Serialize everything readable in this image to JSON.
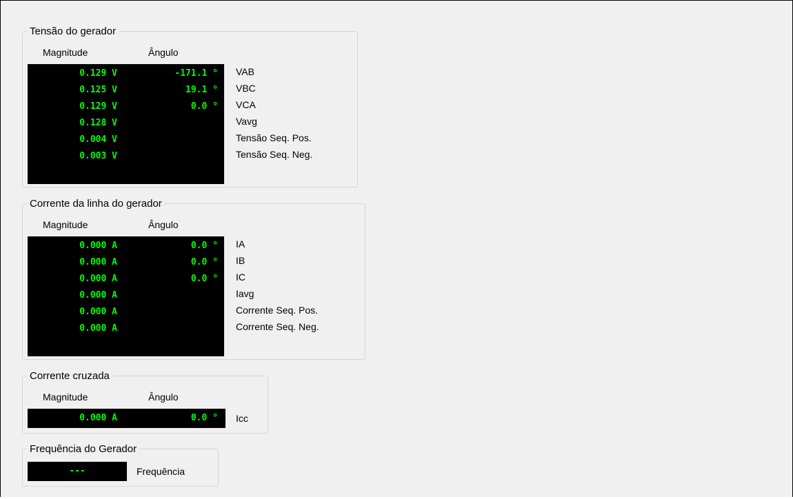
{
  "voltage": {
    "title": "Tensão do gerador",
    "magnitude_header": "Magnitude",
    "angle_header": "Ângulo",
    "rows": [
      {
        "magnitude": "0.129 V",
        "angle": "-171.1 °",
        "label": "VAB"
      },
      {
        "magnitude": "0.125 V",
        "angle": "19.1 °",
        "label": "VBC"
      },
      {
        "magnitude": "0.129 V",
        "angle": "0.0 °",
        "label": "VCA"
      },
      {
        "magnitude": "0.128 V",
        "angle": "",
        "label": "Vavg"
      },
      {
        "magnitude": "0.004 V",
        "angle": "",
        "label": "Tensão Seq. Pos."
      },
      {
        "magnitude": "0.003 V",
        "angle": "",
        "label": "Tensão Seq. Neg."
      }
    ]
  },
  "current": {
    "title": "Corrente da linha do gerador",
    "magnitude_header": "Magnitude",
    "angle_header": "Ângulo",
    "rows": [
      {
        "magnitude": "0.000 A",
        "angle": "0.0 °",
        "label": "IA"
      },
      {
        "magnitude": "0.000 A",
        "angle": "0.0 °",
        "label": "IB"
      },
      {
        "magnitude": "0.000 A",
        "angle": "0.0 °",
        "label": "IC"
      },
      {
        "magnitude": "0.000 A",
        "angle": "",
        "label": "Iavg"
      },
      {
        "magnitude": "0.000 A",
        "angle": "",
        "label": "Corrente Seq. Pos."
      },
      {
        "magnitude": "0.000 A",
        "angle": "",
        "label": "Corrente Seq. Neg."
      }
    ]
  },
  "cross_current": {
    "title": "Corrente cruzada",
    "magnitude_header": "Magnitude",
    "angle_header": "Ângulo",
    "rows": [
      {
        "magnitude": "0.000 A",
        "angle": "0.0 °",
        "label": "Icc"
      }
    ]
  },
  "frequency": {
    "title": "Frequência do Gerador",
    "value": "---",
    "label": "Frequência"
  },
  "colors": {
    "display_background": "#000000",
    "display_text": "#00ff00",
    "window_background": "#f0f0f0"
  }
}
